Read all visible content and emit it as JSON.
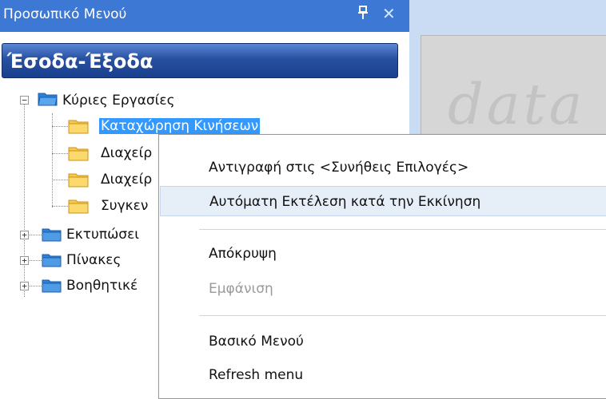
{
  "panel": {
    "title": "Προσωπικό Μενού",
    "section_title": "Έσοδα-Έξοδα"
  },
  "tree": {
    "root": {
      "label": "Κύριες Εργασίες"
    },
    "children": [
      {
        "label": "Καταχώρηση Κινήσεων"
      },
      {
        "label": "Διαχείρ"
      },
      {
        "label": "Διαχείρ"
      },
      {
        "label": "Συγκεν"
      }
    ],
    "groups": [
      {
        "label": "Εκτυπώσει"
      },
      {
        "label": "Πίνακες"
      },
      {
        "label": "Βοηθητικέ"
      }
    ]
  },
  "context_menu": {
    "items": [
      {
        "label": "Αντιγραφή στις <Συνήθεις Επιλογές>"
      },
      {
        "label": "Αυτόματη Εκτέλεση κατά την Εκκίνηση"
      },
      {
        "label": "Απόκρυψη"
      },
      {
        "label": "Εμφάνιση"
      },
      {
        "label": "Βασικό Μενού"
      },
      {
        "label": "Refresh menu"
      }
    ]
  },
  "colors": {
    "titlebar": "#3d78d4",
    "selection": "#3399ff",
    "folder": "#f6c84c"
  }
}
